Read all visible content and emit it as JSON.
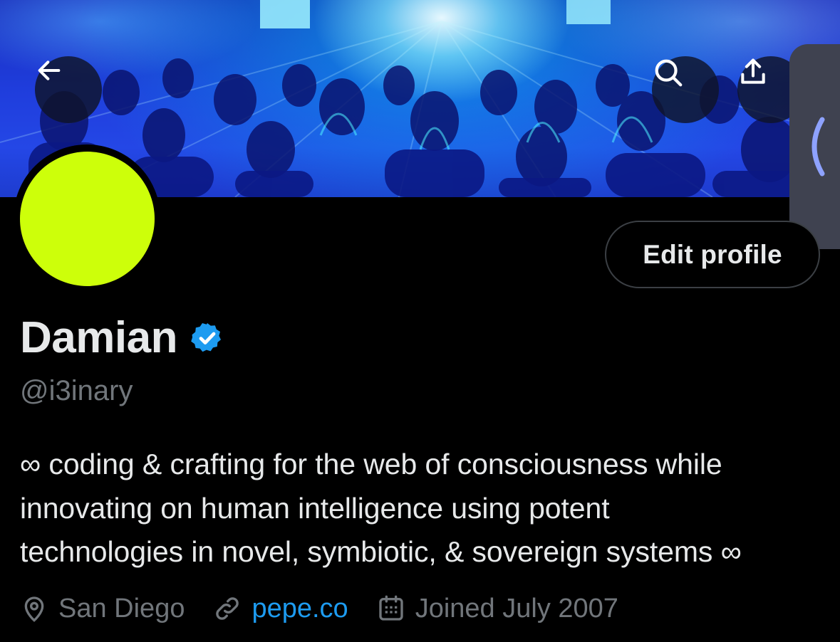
{
  "profile": {
    "display_name": "Damian",
    "handle": "@i3inary",
    "bio_lines": [
      "∞ coding & crafting for the web of consciousness while",
      "innovating on human intelligence using potent",
      "technologies in novel, symbiotic, & sovereign systems ∞"
    ],
    "location": "San Diego",
    "website": "pepe.co",
    "joined": "Joined July 2007",
    "verified": true
  },
  "actions": {
    "edit_profile_label": "Edit profile"
  },
  "icons": {
    "back": "arrow-left-icon",
    "search": "search-icon",
    "share": "share-icon",
    "drawer": "chevron-left-icon",
    "verified": "verified-badge-icon",
    "location": "location-pin-icon",
    "link": "link-icon",
    "calendar": "calendar-icon"
  },
  "colors": {
    "background": "#000000",
    "text_primary": "#e7e9ea",
    "text_secondary": "#71767b",
    "accent_blue": "#1d9bf0",
    "avatar": "#cdff0a",
    "banner_blue": "#2447e6"
  }
}
